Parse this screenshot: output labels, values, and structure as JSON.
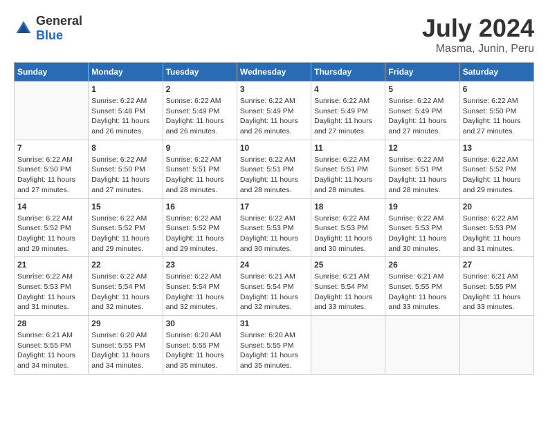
{
  "logo": {
    "general": "General",
    "blue": "Blue"
  },
  "title": {
    "month_year": "July 2024",
    "location": "Masma, Junin, Peru"
  },
  "days_of_week": [
    "Sunday",
    "Monday",
    "Tuesday",
    "Wednesday",
    "Thursday",
    "Friday",
    "Saturday"
  ],
  "weeks": [
    [
      {
        "day": "",
        "sunrise": "",
        "sunset": "",
        "daylight": ""
      },
      {
        "day": "1",
        "sunrise": "Sunrise: 6:22 AM",
        "sunset": "Sunset: 5:48 PM",
        "daylight": "Daylight: 11 hours and 26 minutes."
      },
      {
        "day": "2",
        "sunrise": "Sunrise: 6:22 AM",
        "sunset": "Sunset: 5:49 PM",
        "daylight": "Daylight: 11 hours and 26 minutes."
      },
      {
        "day": "3",
        "sunrise": "Sunrise: 6:22 AM",
        "sunset": "Sunset: 5:49 PM",
        "daylight": "Daylight: 11 hours and 26 minutes."
      },
      {
        "day": "4",
        "sunrise": "Sunrise: 6:22 AM",
        "sunset": "Sunset: 5:49 PM",
        "daylight": "Daylight: 11 hours and 27 minutes."
      },
      {
        "day": "5",
        "sunrise": "Sunrise: 6:22 AM",
        "sunset": "Sunset: 5:49 PM",
        "daylight": "Daylight: 11 hours and 27 minutes."
      },
      {
        "day": "6",
        "sunrise": "Sunrise: 6:22 AM",
        "sunset": "Sunset: 5:50 PM",
        "daylight": "Daylight: 11 hours and 27 minutes."
      }
    ],
    [
      {
        "day": "7",
        "sunrise": "Sunrise: 6:22 AM",
        "sunset": "Sunset: 5:50 PM",
        "daylight": "Daylight: 11 hours and 27 minutes."
      },
      {
        "day": "8",
        "sunrise": "Sunrise: 6:22 AM",
        "sunset": "Sunset: 5:50 PM",
        "daylight": "Daylight: 11 hours and 27 minutes."
      },
      {
        "day": "9",
        "sunrise": "Sunrise: 6:22 AM",
        "sunset": "Sunset: 5:51 PM",
        "daylight": "Daylight: 11 hours and 28 minutes."
      },
      {
        "day": "10",
        "sunrise": "Sunrise: 6:22 AM",
        "sunset": "Sunset: 5:51 PM",
        "daylight": "Daylight: 11 hours and 28 minutes."
      },
      {
        "day": "11",
        "sunrise": "Sunrise: 6:22 AM",
        "sunset": "Sunset: 5:51 PM",
        "daylight": "Daylight: 11 hours and 28 minutes."
      },
      {
        "day": "12",
        "sunrise": "Sunrise: 6:22 AM",
        "sunset": "Sunset: 5:51 PM",
        "daylight": "Daylight: 11 hours and 28 minutes."
      },
      {
        "day": "13",
        "sunrise": "Sunrise: 6:22 AM",
        "sunset": "Sunset: 5:52 PM",
        "daylight": "Daylight: 11 hours and 29 minutes."
      }
    ],
    [
      {
        "day": "14",
        "sunrise": "Sunrise: 6:22 AM",
        "sunset": "Sunset: 5:52 PM",
        "daylight": "Daylight: 11 hours and 29 minutes."
      },
      {
        "day": "15",
        "sunrise": "Sunrise: 6:22 AM",
        "sunset": "Sunset: 5:52 PM",
        "daylight": "Daylight: 11 hours and 29 minutes."
      },
      {
        "day": "16",
        "sunrise": "Sunrise: 6:22 AM",
        "sunset": "Sunset: 5:52 PM",
        "daylight": "Daylight: 11 hours and 29 minutes."
      },
      {
        "day": "17",
        "sunrise": "Sunrise: 6:22 AM",
        "sunset": "Sunset: 5:53 PM",
        "daylight": "Daylight: 11 hours and 30 minutes."
      },
      {
        "day": "18",
        "sunrise": "Sunrise: 6:22 AM",
        "sunset": "Sunset: 5:53 PM",
        "daylight": "Daylight: 11 hours and 30 minutes."
      },
      {
        "day": "19",
        "sunrise": "Sunrise: 6:22 AM",
        "sunset": "Sunset: 5:53 PM",
        "daylight": "Daylight: 11 hours and 30 minutes."
      },
      {
        "day": "20",
        "sunrise": "Sunrise: 6:22 AM",
        "sunset": "Sunset: 5:53 PM",
        "daylight": "Daylight: 11 hours and 31 minutes."
      }
    ],
    [
      {
        "day": "21",
        "sunrise": "Sunrise: 6:22 AM",
        "sunset": "Sunset: 5:53 PM",
        "daylight": "Daylight: 11 hours and 31 minutes."
      },
      {
        "day": "22",
        "sunrise": "Sunrise: 6:22 AM",
        "sunset": "Sunset: 5:54 PM",
        "daylight": "Daylight: 11 hours and 32 minutes."
      },
      {
        "day": "23",
        "sunrise": "Sunrise: 6:22 AM",
        "sunset": "Sunset: 5:54 PM",
        "daylight": "Daylight: 11 hours and 32 minutes."
      },
      {
        "day": "24",
        "sunrise": "Sunrise: 6:21 AM",
        "sunset": "Sunset: 5:54 PM",
        "daylight": "Daylight: 11 hours and 32 minutes."
      },
      {
        "day": "25",
        "sunrise": "Sunrise: 6:21 AM",
        "sunset": "Sunset: 5:54 PM",
        "daylight": "Daylight: 11 hours and 33 minutes."
      },
      {
        "day": "26",
        "sunrise": "Sunrise: 6:21 AM",
        "sunset": "Sunset: 5:55 PM",
        "daylight": "Daylight: 11 hours and 33 minutes."
      },
      {
        "day": "27",
        "sunrise": "Sunrise: 6:21 AM",
        "sunset": "Sunset: 5:55 PM",
        "daylight": "Daylight: 11 hours and 33 minutes."
      }
    ],
    [
      {
        "day": "28",
        "sunrise": "Sunrise: 6:21 AM",
        "sunset": "Sunset: 5:55 PM",
        "daylight": "Daylight: 11 hours and 34 minutes."
      },
      {
        "day": "29",
        "sunrise": "Sunrise: 6:20 AM",
        "sunset": "Sunset: 5:55 PM",
        "daylight": "Daylight: 11 hours and 34 minutes."
      },
      {
        "day": "30",
        "sunrise": "Sunrise: 6:20 AM",
        "sunset": "Sunset: 5:55 PM",
        "daylight": "Daylight: 11 hours and 35 minutes."
      },
      {
        "day": "31",
        "sunrise": "Sunrise: 6:20 AM",
        "sunset": "Sunset: 5:55 PM",
        "daylight": "Daylight: 11 hours and 35 minutes."
      },
      {
        "day": "",
        "sunrise": "",
        "sunset": "",
        "daylight": ""
      },
      {
        "day": "",
        "sunrise": "",
        "sunset": "",
        "daylight": ""
      },
      {
        "day": "",
        "sunrise": "",
        "sunset": "",
        "daylight": ""
      }
    ]
  ]
}
